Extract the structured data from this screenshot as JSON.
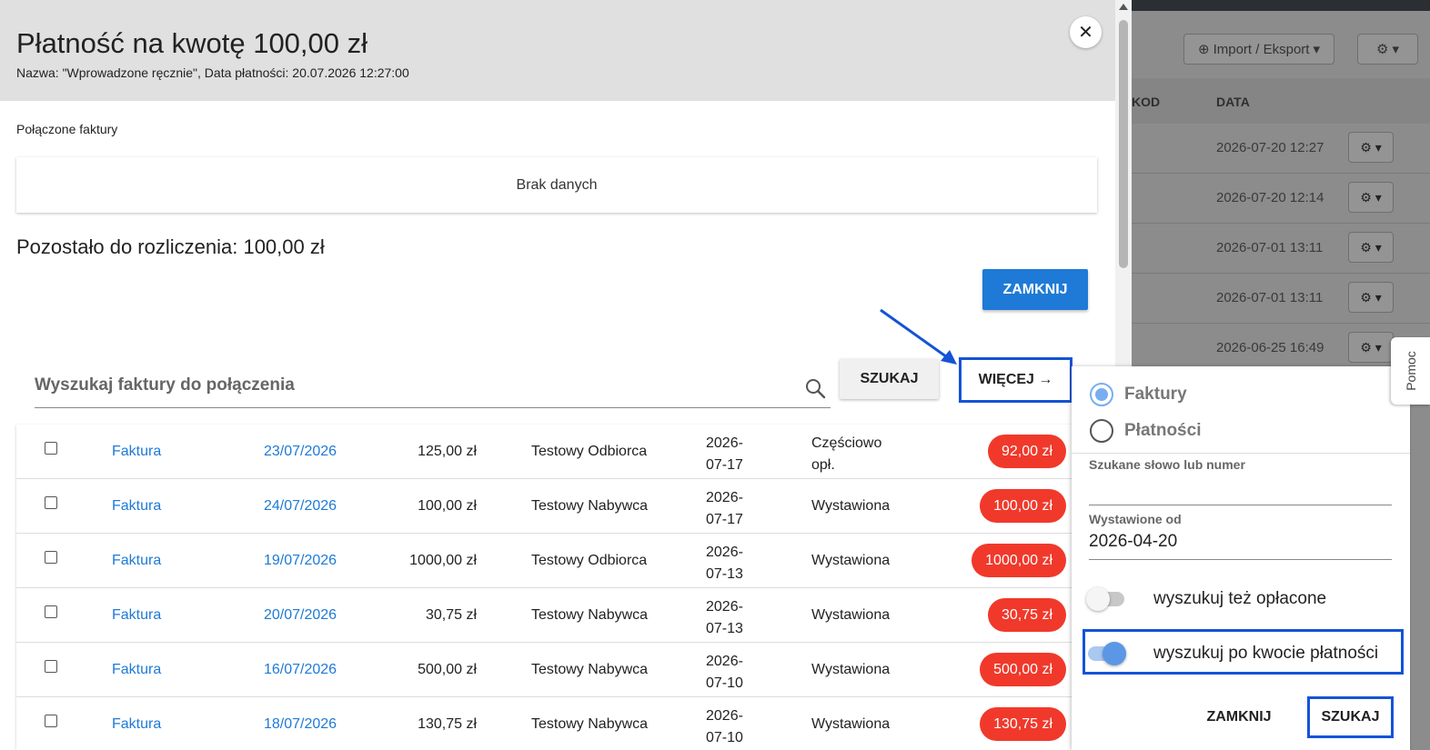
{
  "background": {
    "import_export_label": "Import / Eksport",
    "col_kod": "KOD",
    "col_data": "DATA",
    "dates": [
      "2026-07-20 12:27",
      "2026-07-20 12:14",
      "2026-07-01 13:11",
      "2026-07-01 13:11",
      "2026-06-25 16:49"
    ]
  },
  "modal": {
    "title": "Płatność na kwotę 100,00 zł",
    "subtitle": "Nazwa: \"Wprowadzone ręcznie\", Data płatności: 20.07.2026 12:27:00",
    "close_symbol": "✕",
    "linked_label": "Połączone faktury",
    "no_data": "Brak danych",
    "remaining": "Pozostało do rozliczenia: 100,00 zł",
    "close_button": "ZAMKNIJ"
  },
  "search": {
    "placeholder": "Wyszukaj faktury do połączenia",
    "search_button": "SZUKAJ",
    "more_button": "WIĘCEJ →"
  },
  "invoices": [
    {
      "type": "Faktura",
      "number": "23/07/2026",
      "amount": "125,00 zł",
      "customer": "Testowy Odbiorca",
      "date": "2026-07-17",
      "status": "Częściowo opł.",
      "due": "92,00 zł"
    },
    {
      "type": "Faktura",
      "number": "24/07/2026",
      "amount": "100,00 zł",
      "customer": "Testowy Nabywca",
      "date": "2026-07-17",
      "status": "Wystawiona",
      "due": "100,00 zł"
    },
    {
      "type": "Faktura",
      "number": "19/07/2026",
      "amount": "1000,00 zł",
      "customer": "Testowy Odbiorca",
      "date": "2026-07-13",
      "status": "Wystawiona",
      "due": "1000,00 zł"
    },
    {
      "type": "Faktura",
      "number": "20/07/2026",
      "amount": "30,75 zł",
      "customer": "Testowy Nabywca",
      "date": "2026-07-13",
      "status": "Wystawiona",
      "due": "30,75 zł"
    },
    {
      "type": "Faktura",
      "number": "16/07/2026",
      "amount": "500,00 zł",
      "customer": "Testowy Nabywca",
      "date": "2026-07-10",
      "status": "Wystawiona",
      "due": "500,00 zł"
    },
    {
      "type": "Faktura",
      "number": "18/07/2026",
      "amount": "130,75 zł",
      "customer": "Testowy Nabywca",
      "date": "2026-07-10",
      "status": "Wystawiona",
      "due": "130,75 zł"
    }
  ],
  "panel": {
    "radio_invoices": "Faktury",
    "radio_payments": "Płatności",
    "selected_radio": "Faktury",
    "keyword_label": "Szukane słowo lub numer",
    "keyword_value": "",
    "issued_from_label": "Wystawione od",
    "issued_from_value": "2026-04-20",
    "toggle_paid_label": "wyszukuj też opłacone",
    "toggle_paid_on": false,
    "toggle_amount_label": "wyszukuj po kwocie płatności",
    "toggle_amount_on": true,
    "close_button": "ZAMKNIJ",
    "search_button": "SZUKAJ"
  },
  "help_tab": "Pomoc",
  "colors": {
    "primary": "#1e7ad6",
    "badge": "#f0392b",
    "annotation": "#1453d6"
  }
}
